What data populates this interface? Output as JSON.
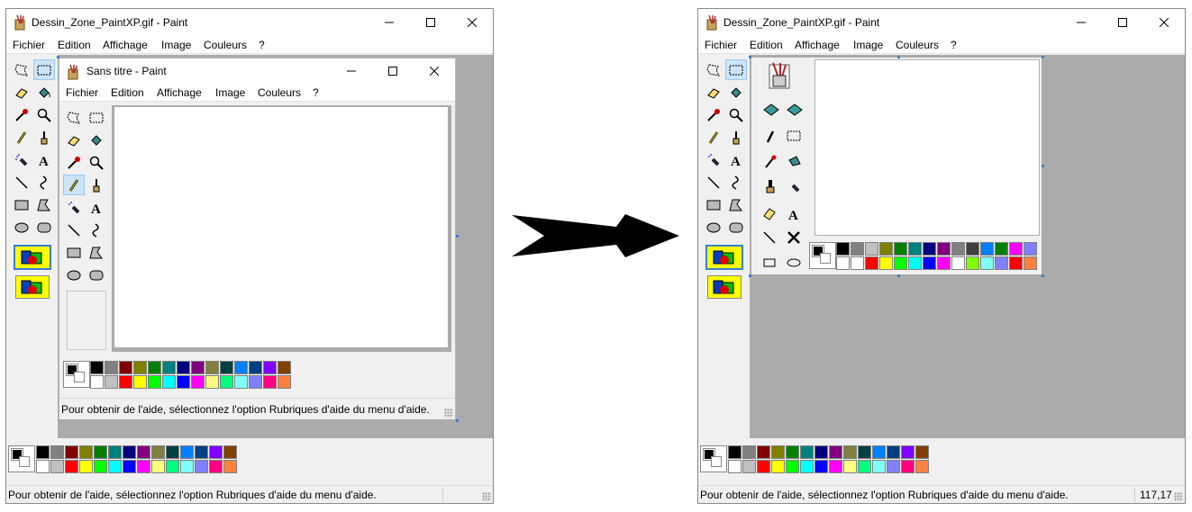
{
  "left_window": {
    "title": "Dessin_Zone_PaintXP.gif - Paint",
    "menu": [
      "Fichier",
      "Edition",
      "Affichage",
      "Image",
      "Couleurs",
      "?"
    ],
    "status_text": "Pour obtenir de l'aide, sélectionnez l'option Rubriques d'aide du menu d'aide.",
    "inner_window": {
      "title": "Sans titre - Paint",
      "menu": [
        "Fichier",
        "Edition",
        "Affichage",
        "Image",
        "Couleurs",
        "?"
      ],
      "status_text": "Pour obtenir de l'aide, sélectionnez l'option Rubriques d'aide du menu d'aide."
    }
  },
  "right_window": {
    "title": "Dessin_Zone_PaintXP.gif - Paint",
    "menu": [
      "Fichier",
      "Edition",
      "Affichage",
      "Image",
      "Couleurs",
      "?"
    ],
    "status_text": "Pour obtenir de l'aide, sélectionnez l'option Rubriques d'aide du menu d'aide.",
    "coords": "117,17"
  },
  "toolbox_icons": [
    "free-select-icon",
    "rect-select-icon",
    "eraser-icon",
    "fill-bucket-icon",
    "color-picker-icon",
    "magnifier-icon",
    "pencil-icon",
    "brush-icon",
    "airbrush-icon",
    "text-icon",
    "line-icon",
    "curve-icon",
    "rectangle-icon",
    "polygon-icon",
    "ellipse-icon",
    "rounded-rect-icon"
  ],
  "palette": {
    "top": [
      "#000000",
      "#808080",
      "#800000",
      "#808000",
      "#008000",
      "#008080",
      "#000080",
      "#800080",
      "#808040",
      "#004040",
      "#0080ff",
      "#004080",
      "#8000ff",
      "#804000"
    ],
    "bottom": [
      "#ffffff",
      "#c0c0c0",
      "#ff0000",
      "#ffff00",
      "#00ff00",
      "#00ffff",
      "#0000ff",
      "#ff00ff",
      "#ffff80",
      "#00ff80",
      "#80ffff",
      "#8080ff",
      "#ff0080",
      "#ff8040"
    ]
  },
  "palette_right_inner": {
    "top": [
      "#000000",
      "#808080",
      "#c0c0c0",
      "#808000",
      "#008000",
      "#008080",
      "#000080",
      "#800080",
      "#808080",
      "#404040",
      "#0080ff",
      "#008000",
      "#ff00ff",
      "#8080ff"
    ],
    "bottom": [
      "#ffffff",
      "#ffffff",
      "#ff0000",
      "#ffff00",
      "#00ff00",
      "#00ffff",
      "#0000ff",
      "#ff00ff",
      "#ffffff",
      "#80ff00",
      "#80ffff",
      "#8080ff",
      "#ff0000",
      "#ff8040"
    ]
  },
  "colors": {
    "workspace": "#ababab",
    "selection": "#cce4f7",
    "handle": "#3b7fd0"
  }
}
